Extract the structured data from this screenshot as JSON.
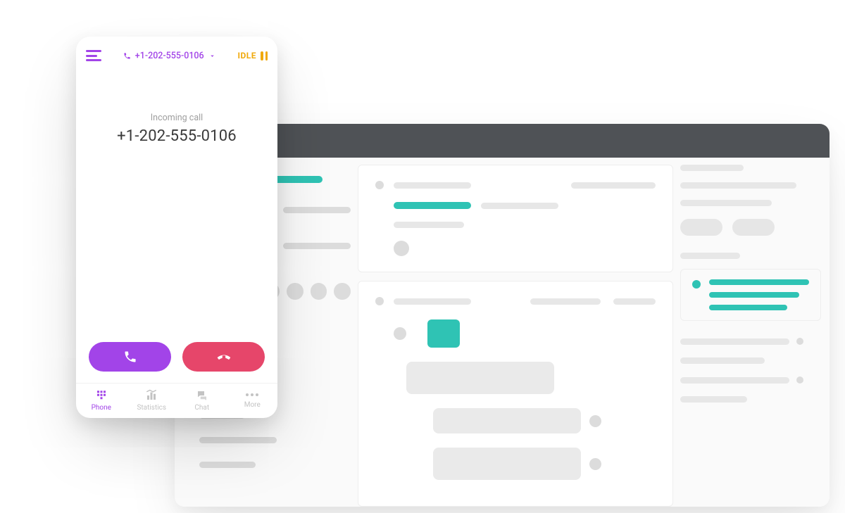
{
  "phone": {
    "header_number": "+1-202-555-0106",
    "status": "IDLE",
    "incoming_label": "Incoming call",
    "incoming_number": "+1-202-555-0106",
    "tabs": {
      "phone": "Phone",
      "statistics": "Statistics",
      "chat": "Chat",
      "more": "More"
    }
  },
  "colors": {
    "accent_purple": "#a244e8",
    "accent_teal": "#2fc3b4",
    "decline_red": "#e6466a",
    "idle_amber": "#f0a90b"
  }
}
